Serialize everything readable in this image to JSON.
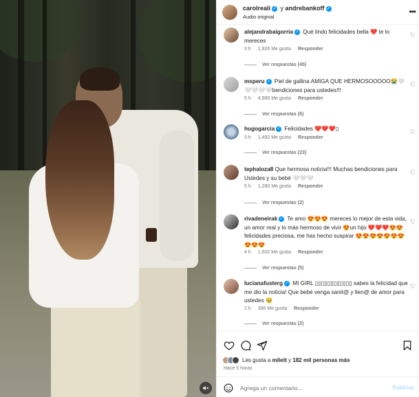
{
  "post": {
    "author1": "carolreali",
    "connector": " y ",
    "author2": "andrebankoff",
    "audio": "Audio original"
  },
  "comments": [
    {
      "user": "alejandrabaigorria",
      "text": "Qué lindo felicidades bella ❤️ te lo mereces",
      "time": "3 h",
      "likes": "1,926 Me gusta",
      "reply": "Responder",
      "view_replies": "Ver respuestas (45)"
    },
    {
      "user": "msperu",
      "text": "Piel de gallina AMIGA QUE HERMOSOOOOO😭🤍🤍🤍🤍🤍bendiciones para ustedes!!!",
      "time": "5 h",
      "likes": "4,989 Me gusta",
      "reply": "Responder",
      "view_replies": "Ver respuestas (6)"
    },
    {
      "user": "hugogarcia",
      "text": "Felicidades ❤️❤️❤️▯",
      "time": "3 h",
      "likes": "1,492 Me gusta",
      "reply": "Responder",
      "view_replies": "Ver respuestas (23)"
    },
    {
      "user": "tephaloza8",
      "text": "Que hermosa noticia!!! Muchas bendiciones para Ustedes y su bebé 🤍🤍🤍",
      "time": "5 h",
      "likes": "1,280 Me gusta",
      "reply": "Responder",
      "view_replies": "Ver respuestas (2)"
    },
    {
      "user": "rivadeneirak",
      "text": "Te amo 😍😍😍 mereces lo mejor de esta vida, un amor real y lo más hermoso de vivir 😍un hijo ❤️❤️❤️😍😍 felicidades preciosa, me has hecho suspirar 😍😍😍😍😍😍😍😍😍😍",
      "time": "4 h",
      "likes": "1,602 Me gusta",
      "reply": "Responder",
      "view_replies": "Ver respuestas (5)"
    },
    {
      "user": "lucianafusterg",
      "text": "MI GIRL ▯▯▯▯▯▯▯▯▯▯▯▯ sabes la felicidad que me dio la noticia! Que bebé venga sanit@ y llen@ de amor para ustedes 🥹",
      "time": "2 h",
      "likes": "396 Me gusta",
      "reply": "Responder",
      "view_replies": "Ver respuestas (2)"
    }
  ],
  "likes_summary": {
    "prefix": "Les gusta a ",
    "user": "milett",
    "middle": " y ",
    "count": "182 mil personas más"
  },
  "time_ago": "Hace 5 horas",
  "add_comment": {
    "placeholder": "Agrega un comentario...",
    "publish": "Publicar"
  },
  "colors": {
    "verified": "#0095f6",
    "like_heart": "#ed4956",
    "publish_disabled": "#b2dffc"
  }
}
